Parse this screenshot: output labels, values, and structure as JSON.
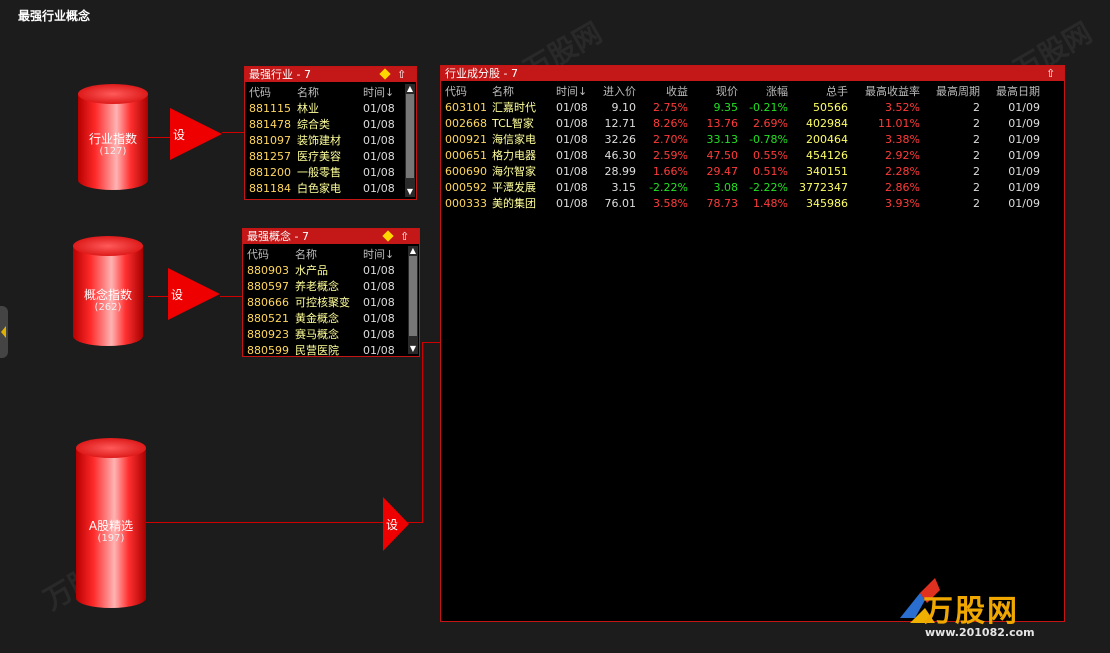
{
  "app": {
    "title": "最强行业概念"
  },
  "nodes": {
    "industry_index": {
      "label": "行业指数",
      "count": "(127)"
    },
    "concept_index": {
      "label": "概念指数",
      "count": "(262)"
    },
    "a_share": {
      "label": "A股精选",
      "count": "(197)"
    }
  },
  "setters": {
    "s1": "设",
    "s2": "设",
    "s3": "设"
  },
  "industry_panel": {
    "title": "最强行业 - 7",
    "headers": {
      "code": "代码",
      "name": "名称",
      "time": "时间↓"
    },
    "rows": [
      {
        "code": "881115",
        "name": "林业",
        "time": "01/08"
      },
      {
        "code": "881478",
        "name": "综合类",
        "time": "01/08"
      },
      {
        "code": "881097",
        "name": "装饰建材",
        "time": "01/08"
      },
      {
        "code": "881257",
        "name": "医疗美容",
        "time": "01/08"
      },
      {
        "code": "881200",
        "name": "一般零售",
        "time": "01/08"
      },
      {
        "code": "881184",
        "name": "白色家电",
        "time": "01/08"
      }
    ]
  },
  "concept_panel": {
    "title": "最强概念 - 7",
    "headers": {
      "code": "代码",
      "name": "名称",
      "time": "时间↓"
    },
    "rows": [
      {
        "code": "880903",
        "name": "水产品",
        "time": "01/08"
      },
      {
        "code": "880597",
        "name": "养老概念",
        "time": "01/08"
      },
      {
        "code": "880666",
        "name": "可控核聚变",
        "time": "01/08"
      },
      {
        "code": "880521",
        "name": "黄金概念",
        "time": "01/08"
      },
      {
        "code": "880923",
        "name": "赛马概念",
        "time": "01/08"
      },
      {
        "code": "880599",
        "name": "民营医院",
        "time": "01/08"
      }
    ]
  },
  "stocks_panel": {
    "title": "行业成分股 - 7",
    "headers": {
      "code": "代码",
      "name": "名称",
      "time": "时间↓",
      "entry": "进入价",
      "gain": "收益",
      "price": "现价",
      "change": "涨幅",
      "volume": "总手",
      "max_rate": "最高收益率",
      "max_period": "最高周期",
      "max_date": "最高日期"
    },
    "rows": [
      {
        "code": "603101",
        "name": "汇嘉时代",
        "time": "01/08",
        "entry": "9.10",
        "gain": "2.75%",
        "price": "9.35",
        "change": "-0.21%",
        "volume": "50566",
        "max_rate": "3.52%",
        "max_period": "2",
        "max_date": "01/09"
      },
      {
        "code": "002668",
        "name": "TCL智家",
        "time": "01/08",
        "entry": "12.71",
        "gain": "8.26%",
        "price": "13.76",
        "change": "2.69%",
        "volume": "402984",
        "max_rate": "11.01%",
        "max_period": "2",
        "max_date": "01/09"
      },
      {
        "code": "000921",
        "name": "海信家电",
        "time": "01/08",
        "entry": "32.26",
        "gain": "2.70%",
        "price": "33.13",
        "change": "-0.78%",
        "volume": "200464",
        "max_rate": "3.38%",
        "max_period": "2",
        "max_date": "01/09"
      },
      {
        "code": "000651",
        "name": "格力电器",
        "time": "01/08",
        "entry": "46.30",
        "gain": "2.59%",
        "price": "47.50",
        "change": "0.55%",
        "volume": "454126",
        "max_rate": "2.92%",
        "max_period": "2",
        "max_date": "01/09"
      },
      {
        "code": "600690",
        "name": "海尔智家",
        "time": "01/08",
        "entry": "28.99",
        "gain": "1.66%",
        "price": "29.47",
        "change": "0.51%",
        "volume": "340151",
        "max_rate": "2.28%",
        "max_period": "2",
        "max_date": "01/09"
      },
      {
        "code": "000592",
        "name": "平潭发展",
        "time": "01/08",
        "entry": "3.15",
        "gain": "-2.22%",
        "price": "3.08",
        "change": "-2.22%",
        "volume": "3772347",
        "max_rate": "2.86%",
        "max_period": "2",
        "max_date": "01/09"
      },
      {
        "code": "000333",
        "name": "美的集团",
        "time": "01/08",
        "entry": "76.01",
        "gain": "3.58%",
        "price": "78.73",
        "change": "1.48%",
        "volume": "345986",
        "max_rate": "3.93%",
        "max_period": "2",
        "max_date": "01/09"
      }
    ]
  },
  "colors": {
    "accent": "#c41818",
    "up": "#ff3b3b",
    "down": "#22e022",
    "code": "#ffd75e"
  },
  "watermark": {
    "text": "万股网",
    "url": "www.201082.com"
  },
  "logo": {
    "text": "万股网",
    "url": "www.201082.com"
  }
}
